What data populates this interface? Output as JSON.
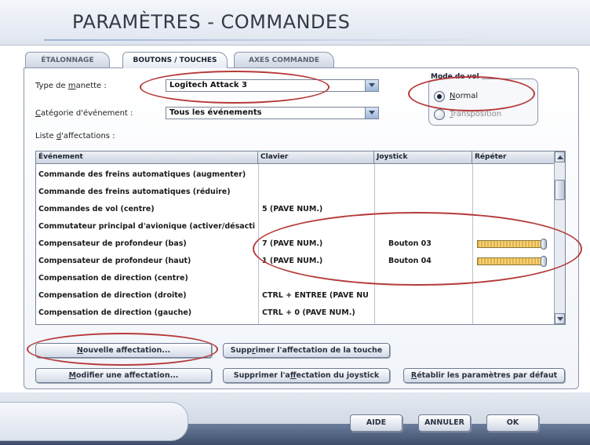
{
  "window": {
    "title": "PARAMÈTRES - COMMANDES"
  },
  "tabs": [
    {
      "label": "ÉTALONNAGE",
      "active": false
    },
    {
      "label": "BOUTONS / TOUCHES",
      "active": true
    },
    {
      "label": "AXES COMMANDE",
      "active": false
    }
  ],
  "controller": {
    "label_pre": "Type de ",
    "label_ul": "m",
    "label_post": "anette :",
    "value": "Logitech Attack 3"
  },
  "event_category": {
    "label_ul": "C",
    "label_post": "atégorie d'événement :",
    "value": "Tous les événements"
  },
  "flight_mode": {
    "title": "Mode de vol",
    "options": [
      {
        "ul": "N",
        "rest": "ormal",
        "selected": true
      },
      {
        "ul": "T",
        "rest": "ransposition",
        "selected": false
      }
    ]
  },
  "assignments": {
    "label_pre": "Liste ",
    "label_ul": "d",
    "label_post": "'affectations :",
    "columns": [
      "Événement",
      "Clavier",
      "Joystick",
      "Répéter"
    ],
    "rows": [
      {
        "event": "Commande des freins automatiques (augmenter)",
        "keyboard": "",
        "joystick": "",
        "repeat": null
      },
      {
        "event": "Commande des freins automatiques (réduire)",
        "keyboard": "",
        "joystick": "",
        "repeat": null
      },
      {
        "event": "Commandes de vol (centre)",
        "keyboard": "5 (PAVE NUM.)",
        "joystick": "",
        "repeat": null
      },
      {
        "event": "Commutateur principal d'avionique (activer/désacti",
        "keyboard": "",
        "joystick": "",
        "repeat": null
      },
      {
        "event": "Compensateur de profondeur (bas)",
        "keyboard": "7 (PAVE NUM.)",
        "joystick": "Bouton 03",
        "repeat": 1.0
      },
      {
        "event": "Compensateur de profondeur (haut)",
        "keyboard": "1 (PAVE NUM.)",
        "joystick": "Bouton 04",
        "repeat": 1.0
      },
      {
        "event": "Compensation de direction (centre)",
        "keyboard": "",
        "joystick": "",
        "repeat": null
      },
      {
        "event": "Compensation de direction (droite)",
        "keyboard": "CTRL + ENTREE (PAVE NU",
        "joystick": "",
        "repeat": null
      },
      {
        "event": "Compensation de direction (gauche)",
        "keyboard": "CTRL + 0 (PAVE NUM.)",
        "joystick": "",
        "repeat": null
      }
    ]
  },
  "buttons": {
    "new_assignment": {
      "ul": "N",
      "rest": "ouvelle affectation..."
    },
    "modify_assignment": {
      "ul": "M",
      "rest": "odifier une affectation..."
    },
    "delete_key": {
      "pre": "Supp",
      "ul": "r",
      "rest": "imer l'affectation de la touche"
    },
    "delete_joystick": {
      "pre": "Supprimer l'a",
      "ul": "f",
      "rest": "fectation du joystick"
    },
    "restore_defaults": {
      "ul": "R",
      "rest": "établir les paramètres par défaut"
    }
  },
  "footer": {
    "help": "AIDE",
    "cancel": "ANNULER",
    "ok": "OK"
  },
  "colors": {
    "annotation": "#b63a3a",
    "slider_fill": "#e6b04a"
  }
}
